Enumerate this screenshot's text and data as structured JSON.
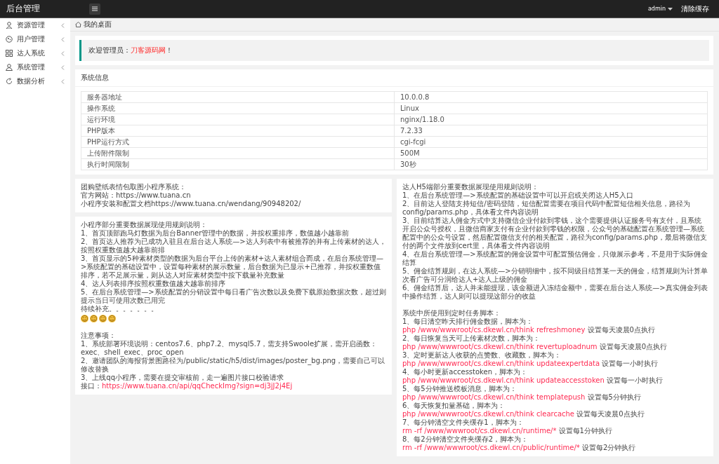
{
  "app_title": "后台管理",
  "topbar": {
    "user": "admin",
    "clear_cache": "清除缓存"
  },
  "sidebar": {
    "items": [
      {
        "label": "资源管理",
        "expanded": false
      },
      {
        "label": "用户管理",
        "expanded": false
      },
      {
        "label": "达人系统",
        "expanded": false
      },
      {
        "label": "系统管理",
        "expanded": false
      },
      {
        "label": "数据分析",
        "expanded": false
      }
    ]
  },
  "breadcrumb": "我的桌面",
  "welcome": {
    "text": "欢迎管理员：",
    "highlight": "刀客源码网",
    "end": "！"
  },
  "system_info": {
    "title": "系统信息",
    "rows": [
      {
        "label": "服务器地址",
        "value": "10.0.0.8"
      },
      {
        "label": "操作系统",
        "value": "Linux"
      },
      {
        "label": "运行环境",
        "value": "nginx/1.18.0"
      },
      {
        "label": "PHP版本",
        "value": "7.2.33"
      },
      {
        "label": "PHP运行方式",
        "value": "cgi-fcgi"
      },
      {
        "label": "上传附件限制",
        "value": "500M"
      },
      {
        "label": "执行时间限制",
        "value": "30秒"
      }
    ]
  },
  "left_cards": [
    {
      "lines": [
        {
          "kind": "text",
          "text": "团购壁纸表情包取图小程序系统："
        },
        {
          "kind": "text",
          "text": "官方网站：https://www.tuana.cn"
        },
        {
          "kind": "text",
          "text": "小程序安装和配置文档https://www.tuana.cn/wendang/90948202/"
        }
      ]
    },
    {
      "lines": [
        {
          "kind": "text",
          "text": "小程序部分重要数据展现使用规则说明："
        },
        {
          "kind": "text",
          "text": "1、首页顶部跑马灯数据为后台Banner管理中的数据，并按权重排序，数值越小越靠前"
        },
        {
          "kind": "text",
          "text": "2、首页达人推荐为已成功入驻且在后台达人系统—>达人列表中有被推荐的并有上传素材的达人，按照权重数值越大越靠前排"
        },
        {
          "kind": "text",
          "text": "3、首页显示的5种素材类型的数据为后台平台上传的素材+达人素材组合而成，在后台系统管理—>系统配置的基础设置中，设置每种素材的展示数量，后台数据为已显示+已推荐，并按权重数值排序，若不足展示量，则从达人对应素材类型中按下载量补充数量"
        },
        {
          "kind": "text",
          "text": "4、达人列表排序按照权重数值越大越靠前排序"
        },
        {
          "kind": "text",
          "text": "5、在后台系统管理—>系统配置的分销设置中每日看广告次数以及免费下载原始数据次数，超过则提示当日可使用次数已用完"
        },
        {
          "kind": "text",
          "text": "待续补充。。。。。。。"
        },
        {
          "kind": "emoji",
          "faces": [
            "☺",
            "☺",
            "☺",
            "☺"
          ]
        },
        {
          "kind": "gap"
        },
        {
          "kind": "text",
          "text": "注意事项："
        },
        {
          "kind": "text",
          "text": "1、系统部署环境说明：centos7.6、php7.2、mysql5.7，需支持Swoole扩展，需开启函数：exec、shell_exec、proc_open"
        },
        {
          "kind": "text",
          "text": "2、邀请团队的海报背景图路径为/public/static/h5/dist/images/poster_bg.png，需要自己可以修改替换"
        },
        {
          "kind": "text",
          "text": "3、上线qq小程序，需要在提交审核前，走一遍图片接口校验请求"
        },
        {
          "kind": "link",
          "label": "接口：",
          "url": "https://www.tuana.cn/api/qqCheckImg?sign=dj3jJ2j4Ej"
        }
      ]
    }
  ],
  "right_card": {
    "lines": [
      {
        "kind": "text",
        "text": "达人H5端部分重要数据展现使用规则说明："
      },
      {
        "kind": "text",
        "text": "1、在后台系统管理—>系统配置的基础设置中可以开启或关闭达人H5入口"
      },
      {
        "kind": "text",
        "text": "2、目前达人登陆支持短信/密码登陆，短信配置需要在项目代码中配置短信相关信息，路径为config/params.php，具体看文件内容说明"
      },
      {
        "kind": "text",
        "text": "3、目前结算达人佣金方式中支持微信企业付款到零钱，这个需要提供认证服务号有支付，且系统开启公众号授权，且微信商家支付有企业付款到零钱的权限，公众号的基础配置在系统管理—系统配置中的公众号设置，然后配置微信支付的相关配置，路径为config/params.php，最后将微信支付的两个文件放到cert里，具体看文件内容说明"
      },
      {
        "kind": "text",
        "text": "4、在后台系统管理—>系统配置的佣金设置中可配置预估佣金，只做展示参考，不是用于实际佣金结算"
      },
      {
        "kind": "text",
        "text": "5、佣金结算规则，在达人系统—>分销明细中，按不同级目结算某一天的佣金，结算规则为计算单次看广告可分润给达人+达人上级的佣金"
      },
      {
        "kind": "text",
        "text": "6、佣金结算后，达人并未能提现，该金额进入冻结金额中，需要在后台达人系统—>真实佣金列表中操作结算，达人则可以提现这部分的收益"
      },
      {
        "kind": "gap"
      },
      {
        "kind": "text",
        "text": "系统中所使用到定时任务脚本："
      },
      {
        "kind": "text",
        "text": "1、每日清空昨天排行佣金数据，脚本为："
      },
      {
        "kind": "command",
        "command": "php /www/wwwroot/cs.dkewl.cn/think refreshmoney",
        "note": "设置每天凌晨0点执行"
      },
      {
        "kind": "text",
        "text": "2、每日恢复当天可上传素材次数，脚本为："
      },
      {
        "kind": "command",
        "command": "php /www/wwwroot/cs.dkewl.cn/think revertuploadnum",
        "note": "设置每天凌晨0点执行"
      },
      {
        "kind": "text",
        "text": "3、定时更新达人收获的点赞数、收藏数，脚本为："
      },
      {
        "kind": "command",
        "command": "php /www/wwwroot/cs.dkewl.cn/think updateexpertdata",
        "note": "设置每一小时执行"
      },
      {
        "kind": "text",
        "text": "4、每小时更新accesstoken，脚本为："
      },
      {
        "kind": "command",
        "command": "php /www/wwwroot/cs.dkewl.cn/think updateaccesstoken",
        "note": "设置每一小时执行"
      },
      {
        "kind": "text",
        "text": "5、每5分钟推送模板消息，脚本为："
      },
      {
        "kind": "command",
        "command": "php /www/wwwroot/cs.dkewl.cn/think templatepush",
        "note": "设置每5分钟执行"
      },
      {
        "kind": "text",
        "text": "6、每天恢复扣量基础，脚本为："
      },
      {
        "kind": "command",
        "command": "php /www/wwwroot/cs.dkewl.cn/think clearcache",
        "note": "设置每天凌晨0点执行"
      },
      {
        "kind": "text",
        "text": "7、每分钟清空文件夹缓存1，脚本为："
      },
      {
        "kind": "command",
        "command": "rm -rf /www/wwwroot/cs.dkewl.cn/runtime/*",
        "note": "设置每1分钟执行"
      },
      {
        "kind": "text",
        "text": "8、每2分钟清空文件夹缓存2，脚本为："
      },
      {
        "kind": "command",
        "command": "rm -rf /www/wwwroot/cs.dkewl.cn/public/runtime/*",
        "note": "设置每2分钟执行"
      }
    ]
  }
}
